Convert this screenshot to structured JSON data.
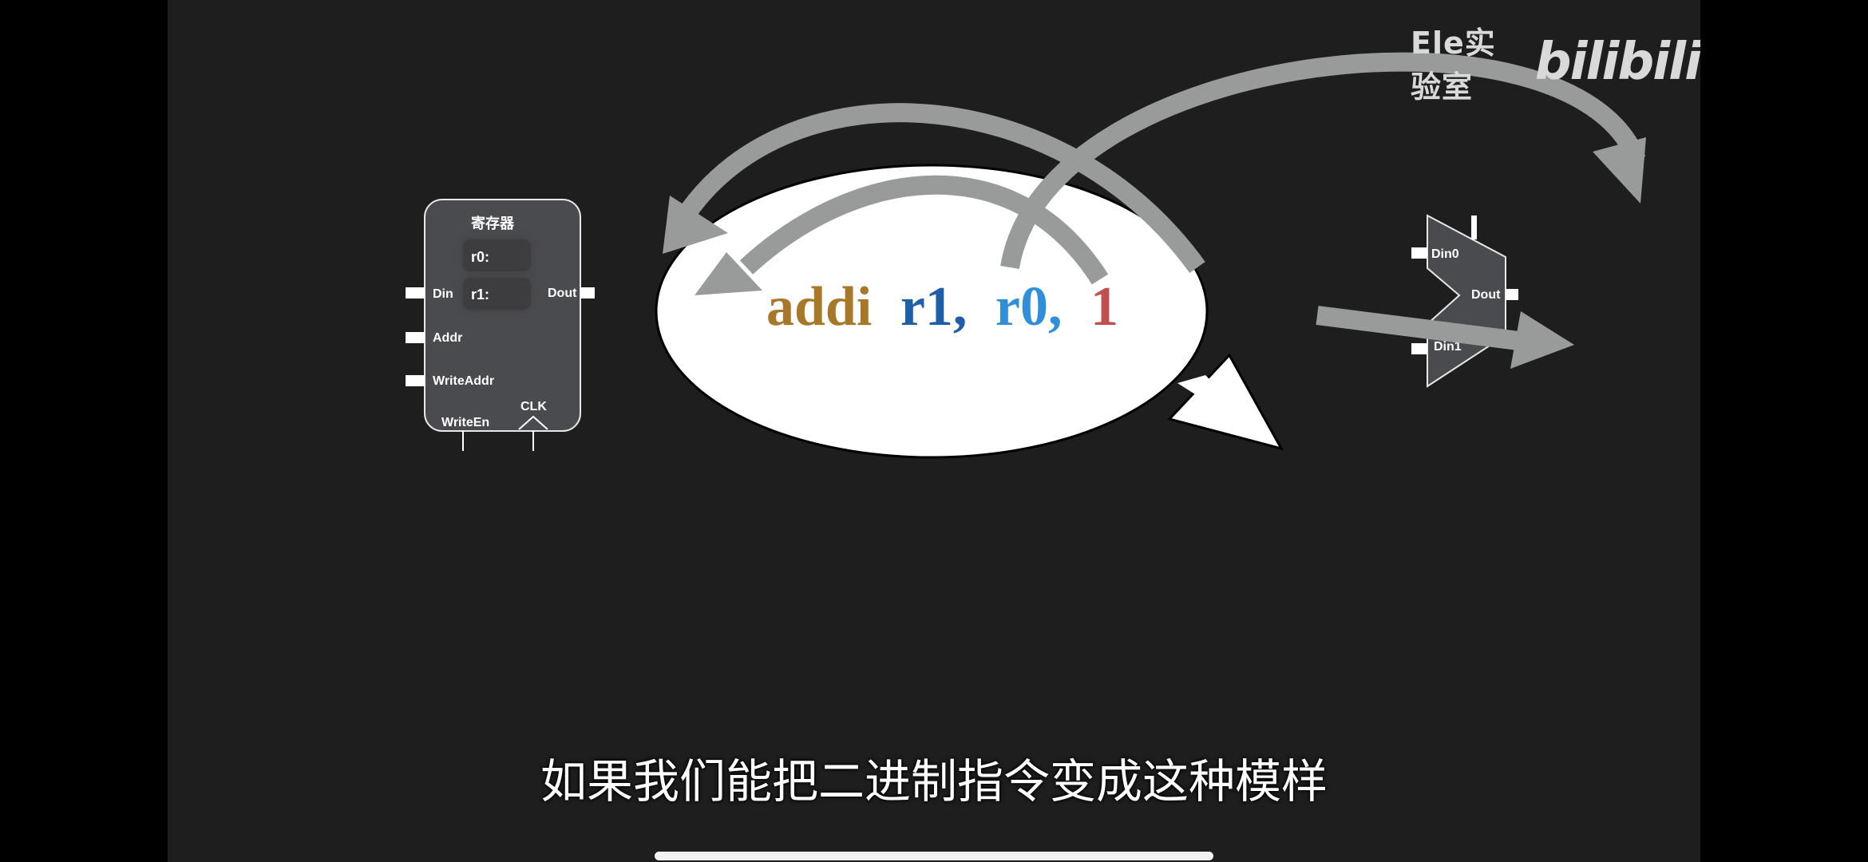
{
  "watermark": {
    "text": "Ele实验室",
    "logo": "bilibili"
  },
  "register_block": {
    "title": "寄存器",
    "r0": "r0:",
    "r1": "r1:",
    "din": "Din",
    "addr": "Addr",
    "write_addr": "WriteAddr",
    "write_en": "WriteEn",
    "clk": "CLK",
    "dout": "Dout"
  },
  "instruction": {
    "op": "addi",
    "rd": "r1,",
    "rs": "r0,",
    "imm": "1"
  },
  "alu_block": {
    "din0": "Din0",
    "din1": "Din1",
    "dout": "Dout"
  },
  "subtitle": "如果我们能把二进制指令变成这种模样",
  "colors": {
    "op": "#a8782a",
    "rd": "#1f5fa8",
    "rs": "#2f8fd8",
    "imm": "#c0504d",
    "arrow": "#999b9b"
  }
}
